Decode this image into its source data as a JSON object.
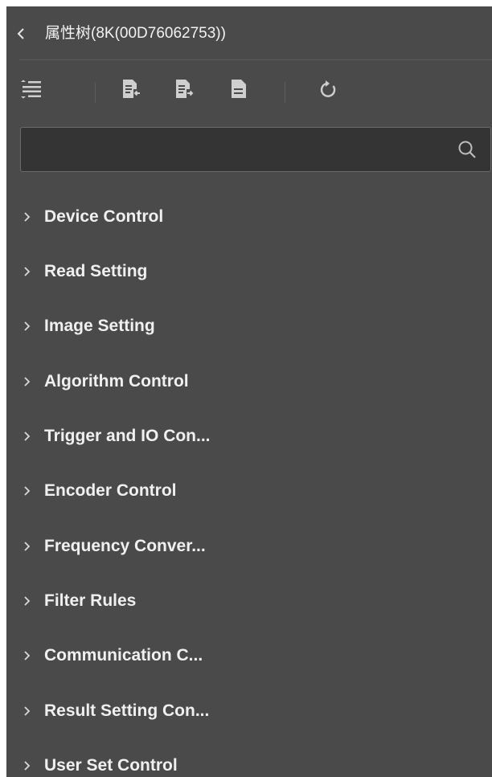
{
  "header": {
    "title": "属性树(8K(00D76062753))"
  },
  "toolbar": {
    "icons": [
      "list-indent-icon",
      "import-icon",
      "export-icon",
      "document-icon",
      "refresh-icon"
    ]
  },
  "search": {
    "value": "",
    "placeholder": ""
  },
  "tree": {
    "items": [
      {
        "label": "Device Control"
      },
      {
        "label": "Read Setting"
      },
      {
        "label": "Image Setting"
      },
      {
        "label": "Algorithm Control"
      },
      {
        "label": "Trigger and IO Con..."
      },
      {
        "label": "Encoder Control"
      },
      {
        "label": "Frequency Conver..."
      },
      {
        "label": "Filter Rules"
      },
      {
        "label": "Communication C..."
      },
      {
        "label": "Result Setting Con..."
      },
      {
        "label": "User Set Control"
      }
    ]
  },
  "colors": {
    "panel": "#4a4a4a",
    "search_bg": "#343434",
    "text": "#f0f0f0",
    "icon": "#cfcfcf"
  }
}
